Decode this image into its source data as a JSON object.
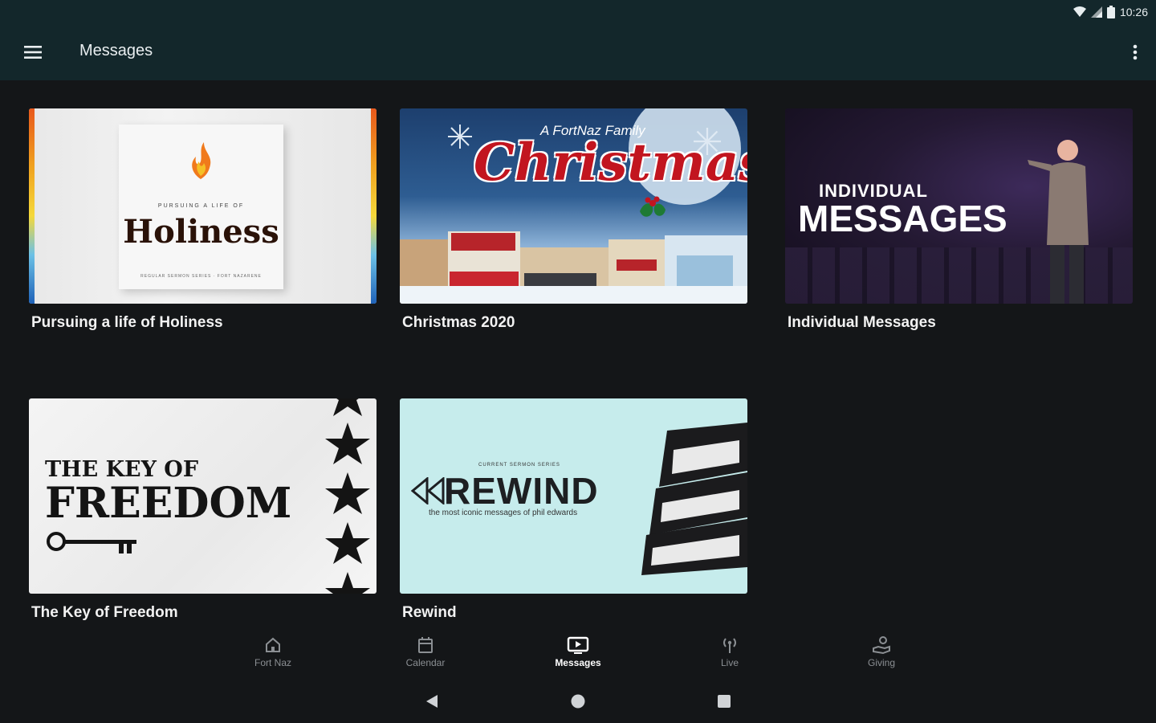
{
  "status_bar": {
    "time": "10:26"
  },
  "toolbar": {
    "title": "Messages"
  },
  "cards": [
    {
      "title": "Pursuing a life of Holiness",
      "art_pre": "PURSUING A LIFE OF",
      "art_main": "Holiness",
      "art_sub": "REGULAR SERMON SERIES · FORT NAZARENE"
    },
    {
      "title": "Christmas 2020",
      "art_top": "A FortNaz Family",
      "art_main": "Christmas"
    },
    {
      "title": "Individual Messages",
      "art_small": "INDIVIDUAL",
      "art_big": "MESSAGES"
    },
    {
      "title": "The Key of Freedom",
      "art_small": "THE KEY OF",
      "art_big": "FREEDOM"
    },
    {
      "title": "Rewind",
      "art_kicker": "CURRENT SERMON SERIES",
      "art_word": "REWIND",
      "art_tag": "the most iconic messages of phil edwards"
    }
  ],
  "bottom_nav": [
    {
      "label": "Fort Naz",
      "icon": "home-icon"
    },
    {
      "label": "Calendar",
      "icon": "calendar-icon"
    },
    {
      "label": "Messages",
      "icon": "tv-icon",
      "active": true
    },
    {
      "label": "Live",
      "icon": "live-broadcast-icon"
    },
    {
      "label": "Giving",
      "icon": "giving-hand-icon"
    }
  ],
  "colors": {
    "toolbar_bg": "#13272b",
    "page_bg": "#141618",
    "nav_inactive": "#8b8f93",
    "nav_active": "#ffffff"
  }
}
